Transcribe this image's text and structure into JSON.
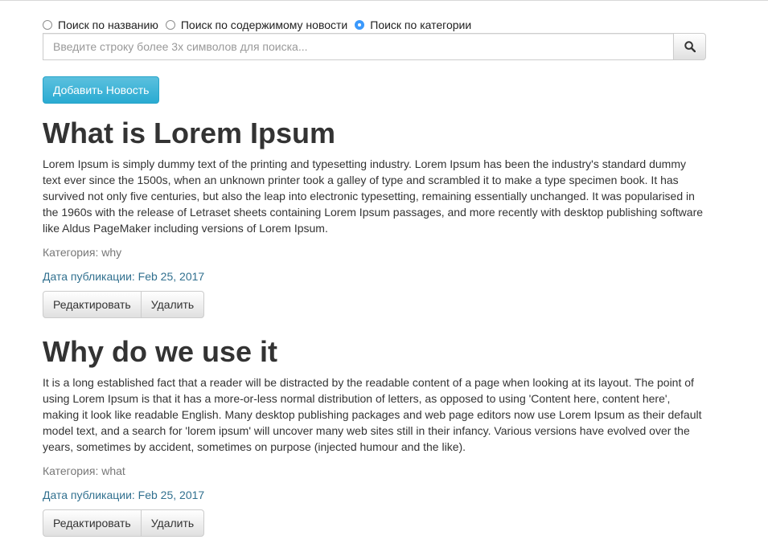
{
  "search_modes": [
    {
      "label": "Поиск по названию",
      "checked": false
    },
    {
      "label": "Поиск по содержимому новости",
      "checked": false
    },
    {
      "label": "Поиск по категории",
      "checked": true
    }
  ],
  "search": {
    "placeholder": "Введите строку более 3х символов для поиска...",
    "value": "",
    "button_icon": "search-icon"
  },
  "add_button_label": "Добавить Новость",
  "accent_color": "#3b99fc",
  "articles": [
    {
      "title": "What is Lorem Ipsum",
      "body": "Lorem Ipsum is simply dummy text of the printing and typesetting industry. Lorem Ipsum has been the industry's standard dummy text ever since the 1500s, when an unknown printer took a galley of type and scrambled it to make a type specimen book. It has survived not only five centuries, but also the leap into electronic typesetting, remaining essentially unchanged. It was popularised in the 1960s with the release of Letraset sheets containing Lorem Ipsum passages, and more recently with desktop publishing software like Aldus PageMaker including versions of Lorem Ipsum.",
      "category": "Категория: why",
      "date": "Дата публикации: Feb 25, 2017",
      "edit_label": "Редактировать",
      "delete_label": "Удалить"
    },
    {
      "title": "Why do we use it",
      "body": "It is a long established fact that a reader will be distracted by the readable content of a page when looking at its layout. The point of using Lorem Ipsum is that it has a more-or-less normal distribution of letters, as opposed to using 'Content here, content here', making it look like readable English. Many desktop publishing packages and web page editors now use Lorem Ipsum as their default model text, and a search for 'lorem ipsum' will uncover many web sites still in their infancy. Various versions have evolved over the years, sometimes by accident, sometimes on purpose (injected humour and the like).",
      "category": "Категория: what",
      "date": "Дата публикации: Feb 25, 2017",
      "edit_label": "Редактировать",
      "delete_label": "Удалить"
    }
  ]
}
